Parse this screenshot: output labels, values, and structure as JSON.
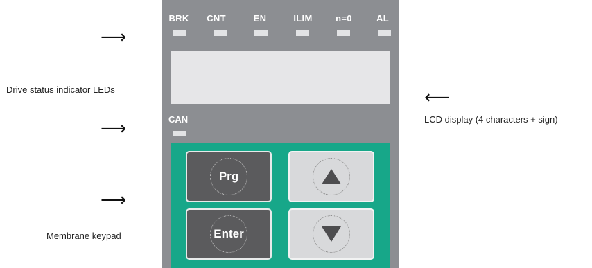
{
  "annotations": {
    "status_leds": "Drive status indicator LEDs",
    "lcd": "LCD display (4 characters + sign)",
    "keypad": "Membrane keypad"
  },
  "panel": {
    "leds": [
      "BRK",
      "CNT",
      "EN",
      "ILIM",
      "n=0",
      "AL"
    ],
    "can_label": "CAN"
  },
  "keypad": {
    "prg_label": "Prg",
    "enter_label": "Enter",
    "up_icon": "up-triangle-icon",
    "down_icon": "down-triangle-icon"
  },
  "colors": {
    "panel_gray": "#8c8e92",
    "keypad_green": "#17a789",
    "dark_key": "#5b5b5d",
    "light_key": "#d8d9db"
  }
}
